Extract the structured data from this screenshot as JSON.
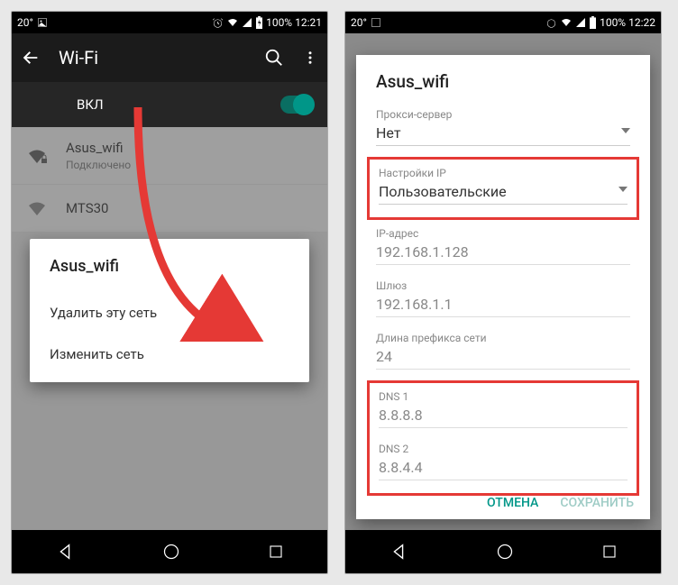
{
  "left": {
    "status": {
      "temp": "20°",
      "battery": "100%",
      "time": "12:21"
    },
    "toolbar": {
      "title": "Wi-Fi"
    },
    "subheader": {
      "label": "ВКЛ"
    },
    "networks": [
      {
        "name": "Asus_wifi",
        "status": "Подключено"
      },
      {
        "name": "MTS30",
        "status": ""
      }
    ],
    "contextmenu": {
      "title": "Asus_wifi",
      "items": [
        "Удалить эту сеть",
        "Изменить сеть"
      ]
    }
  },
  "right": {
    "status": {
      "temp": "20°",
      "battery": "100%",
      "time": "12:22"
    },
    "dialog": {
      "title": "Asus_wifi",
      "proxy_label": "Прокси-сервер",
      "proxy_value": "Нет",
      "ip_settings_label": "Настройки IP",
      "ip_settings_value": "Пользовательские",
      "ip_label": "IP-адрес",
      "ip_value": "192.168.1.128",
      "gateway_label": "Шлюз",
      "gateway_value": "192.168.1.1",
      "prefix_label": "Длина префикса сети",
      "prefix_value": "24",
      "dns1_label": "DNS 1",
      "dns1_value": "8.8.8.8",
      "dns2_label": "DNS 2",
      "dns2_value": "8.8.4.4",
      "cancel": "ОТМЕНА",
      "save": "СОХРАНИТЬ"
    }
  }
}
